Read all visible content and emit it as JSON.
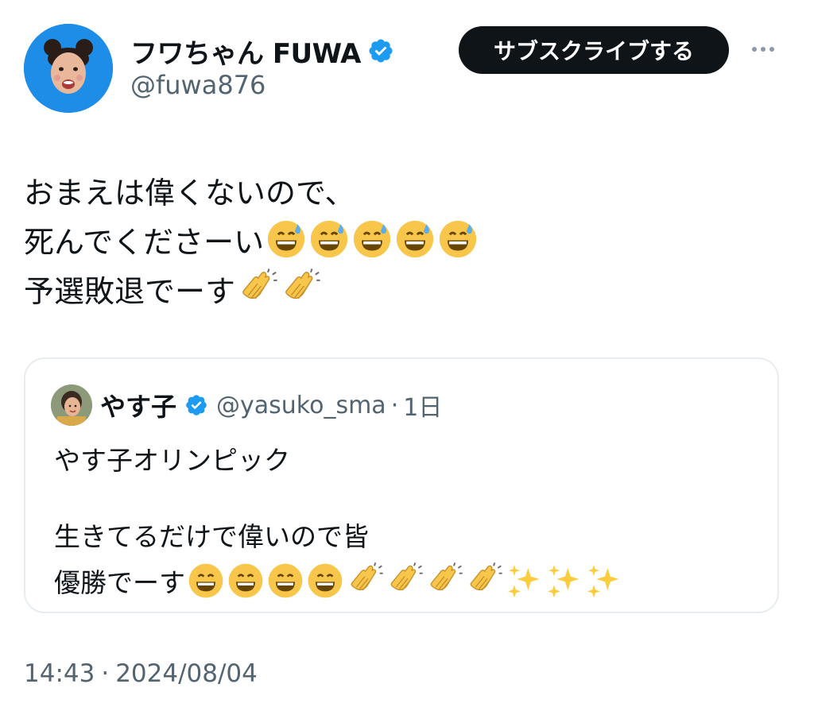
{
  "author": {
    "display_name": "フワちゃん FUWA",
    "handle": "@fuwa876",
    "verified": true
  },
  "header": {
    "subscribe_label": "サブスクライブする",
    "more_icon": "more-horizontal-icon"
  },
  "tweet": {
    "lines": [
      "おまえは偉くないので、",
      "死んでくださーい",
      "予選敗退でーす"
    ],
    "line2_emoji": [
      "grinning-sweat-face",
      "grinning-sweat-face",
      "grinning-sweat-face",
      "grinning-sweat-face",
      "grinning-sweat-face"
    ],
    "line3_emoji": [
      "clapping-hands",
      "clapping-hands"
    ]
  },
  "quote": {
    "display_name": "やす子",
    "verified": true,
    "handle": "@yasuko_sma",
    "separator": "·",
    "time": "1日",
    "lines": [
      "やす子オリンピック",
      "生きてるだけで偉いので皆",
      "優勝でーす"
    ],
    "line3_emoji": [
      "grinning-face",
      "grinning-face",
      "grinning-face",
      "grinning-face",
      "clapping-hands",
      "clapping-hands",
      "clapping-hands",
      "clapping-hands",
      "sparkles",
      "sparkles",
      "sparkles"
    ]
  },
  "footer": {
    "time": "14:43",
    "separator": "·",
    "date": "2024/08/04"
  },
  "colors": {
    "verified_blue": "#1d9bf0",
    "avatar_blue": "#1d8de8",
    "button_bg": "#0f1419",
    "muted_text": "#536471"
  }
}
